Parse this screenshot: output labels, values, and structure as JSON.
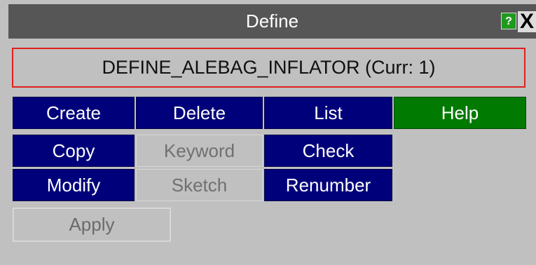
{
  "window": {
    "title": "Define",
    "help_glyph": "?",
    "close_glyph": "X"
  },
  "keyword": {
    "label": "DEFINE_ALEBAG_INFLATOR (Curr: 1)"
  },
  "buttons": {
    "create": "Create",
    "delete": "Delete",
    "list": "List",
    "help": "Help",
    "copy": "Copy",
    "keyword": "Keyword",
    "check": "Check",
    "modify": "Modify",
    "sketch": "Sketch",
    "renumber": "Renumber",
    "apply": "Apply"
  },
  "icons": {
    "help": "question-mark-icon",
    "close": "close-icon"
  },
  "colors": {
    "titlebar": "#565656",
    "button_blue": "#00007a",
    "button_green": "#007a00",
    "panel": "#c0c0c0",
    "keyword_border": "#e02020"
  }
}
